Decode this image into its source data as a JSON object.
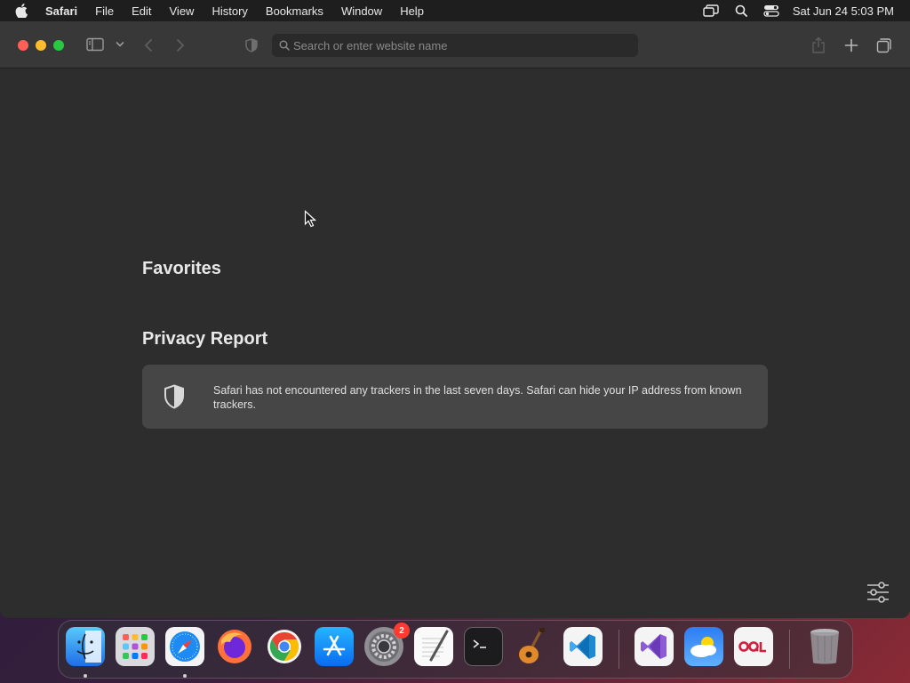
{
  "menubar": {
    "app_name": "Safari",
    "items": [
      "File",
      "Edit",
      "View",
      "History",
      "Bookmarks",
      "Window",
      "Help"
    ],
    "clock": "Sat Jun 24  5:03 PM"
  },
  "toolbar": {
    "search_placeholder": "Search or enter website name"
  },
  "start_page": {
    "favorites_title": "Favorites",
    "privacy_title": "Privacy Report",
    "privacy_message": "Safari has not encountered any trackers in the last seven days. Safari can hide your IP address from known trackers."
  },
  "dock": {
    "apps": [
      "finder",
      "launchpad",
      "safari",
      "firefox",
      "chrome",
      "app-store",
      "system-settings",
      "textedit",
      "terminal",
      "garageband",
      "vscode",
      "visual-studio",
      "weather",
      "sql-app",
      "trash"
    ],
    "system_settings_badge": "2"
  },
  "colors": {
    "close": "#ff5f57",
    "minimize": "#febc2e",
    "maximize": "#28c840",
    "badge": "#ff3b30"
  }
}
